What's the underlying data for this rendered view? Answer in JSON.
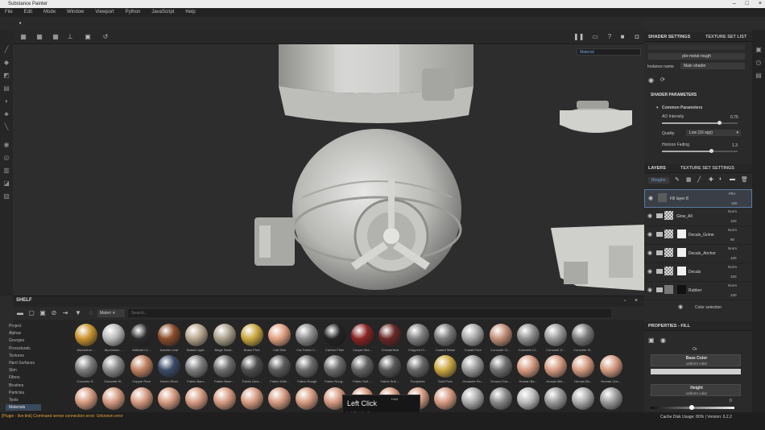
{
  "app": {
    "title": "Substance Painter"
  },
  "menu": [
    "File",
    "Edit",
    "Mode",
    "Window",
    "Viewport",
    "Python",
    "JavaScript",
    "Help"
  ],
  "viewport": {
    "display_mode": "Material"
  },
  "shader_settings": {
    "tab_label": "SHADER SETTINGS",
    "texture_set_list_tab": "TEXTURE SET LIST",
    "shader_name": "pbr-metal-rough",
    "instance_name_label": "Instance name",
    "instance_name_value": "Main shader",
    "section_title": "SHADER PARAMETERS",
    "common_parameters": "Common Parameters",
    "ao_intensity_label": "AO Intensity",
    "ao_intensity_value": "0.75",
    "ao_intensity": 0.75,
    "quality_label": "Quality",
    "quality_value": "Low (16 spp)",
    "horizon_fading_label": "Horizon Fading",
    "horizon_fading_value": "1.3",
    "horizon_fading": 0.65
  },
  "layers_panel": {
    "tab_label": "LAYERS",
    "texture_set_settings_tab": "TEXTURE SET SETTINGS",
    "channel_dropdown": "Roughn",
    "layers": [
      {
        "name": "Fill layer 8",
        "blend": "Pthr",
        "opacity": "100",
        "selected": true
      },
      {
        "name": "Glow_All",
        "blend": "Norm",
        "opacity": "100"
      },
      {
        "name": "Decals_Grime",
        "blend": "Norm",
        "opacity": "90"
      },
      {
        "name": "Decals_Anchor",
        "blend": "Norm",
        "opacity": "100"
      },
      {
        "name": "Decals",
        "blend": "Norm",
        "opacity": "100"
      },
      {
        "name": "Rubber",
        "blend": "Norm",
        "opacity": "100"
      }
    ],
    "sub_item": "Color selection"
  },
  "properties_fill": {
    "title": "PROPERTIES - FILL",
    "or_label": "Or",
    "base_color_label": "Base Color",
    "base_color_sub": "uniform color",
    "height_label": "Height",
    "height_sub": "uniform color",
    "height_value": "0"
  },
  "shelf": {
    "title": "SHELF",
    "filter_chip": "Materi",
    "search_placeholder": "Search...",
    "categories": [
      "Project",
      "Alphas",
      "Grunges",
      "Procedurals",
      "Textures",
      "Hard Surfaces",
      "Skin",
      "Filters",
      "Brushes",
      "Particles",
      "Tools",
      "Materials"
    ],
    "selected_category": "Materials",
    "materials_row1": [
      "Aluminium ...",
      "Aluminium ...",
      "Artificial Le...",
      "Autumn Leaf",
      "Baked Light...",
      "Beige Sand...",
      "Brass Pure",
      "Calf Skin",
      "Car Fabric C...",
      "Carbon Fiber",
      "Carpet Sha...",
      "Chesterfield",
      "Chipped Cl...",
      "Coated Metal",
      "Cobalt Pure",
      "Concrete Cl...",
      "Concrete Cl...",
      "Concrete D...",
      "Concrete Sl..."
    ],
    "materials_row2": [
      "Concrete S...",
      "Concrete W...",
      "Copper Pure",
      "Denim Rivet",
      "Fabric Bam...",
      "Fabric Base...",
      "Fabric Deni...",
      "Fabric Knitt...",
      "Fabric Rough",
      "Fabric Roug...",
      "Fabric Soft ...",
      "Fabric Suit ...",
      "Footprints",
      "Gold Pure",
      "Gouache Pa...",
      "Ground Gra...",
      "Human Ba...",
      "Human Bel...",
      "Human Bu...",
      "Human Che..."
    ],
    "swatch_colors_row1": [
      "#c8922d",
      "#b9b9b9",
      "#2a2a2a",
      "#8a4b2a",
      "#b7a58e",
      "#a9a08a",
      "#c9a640",
      "#e0a080",
      "#8d8d8d",
      "#222222",
      "#8a2222",
      "#6a2626",
      "#7f7f7f",
      "#7a7a7a",
      "#a7a7a7",
      "#c28e76",
      "#8f8f8f",
      "#9a9a9a",
      "#7b7b7b"
    ],
    "swatch_colors_row2": [
      "#7c7c7c",
      "#8a8a8a",
      "#c08060",
      "#3a4a66",
      "#7d7d7d",
      "#6d6d6d",
      "#4d4d4d",
      "#5a5a5a",
      "#6a6a6a",
      "#6b6b6b",
      "#626262",
      "#575757",
      "#666666",
      "#c9a640",
      "#9a9a9a",
      "#6f6f6f",
      "#d59a80",
      "#d59a80",
      "#d59a80",
      "#d59a80"
    ],
    "swatch_colors_row3": [
      "#d59a80",
      "#d59a80",
      "#d59a80",
      "#d59a80",
      "#d59a80",
      "#d59a80",
      "#d59a80",
      "#d59a80",
      "#d59a80",
      "#d59a80",
      "#d59a80",
      "#d59a80",
      "#d59a80",
      "#d59a80",
      "#aaaaaa",
      "#888888",
      "#bbbbbb",
      "#999999",
      "#aaaaaa",
      "#9a9a9a"
    ]
  },
  "tooltip": {
    "title": "Left Click",
    "hold_label": "Hold",
    "line1": "Left Click [Hold]",
    "line2": "Left Click [Hold]"
  },
  "status": {
    "error": "[Plugin - live-link] Command server connection error: Unknown error",
    "cache": "Cache Disk Usage: 80% | Version: 6.2.2"
  },
  "colors": {
    "accent": "#3a4a5e",
    "warning": "#e2a23b",
    "link": "#6fa0d8"
  }
}
